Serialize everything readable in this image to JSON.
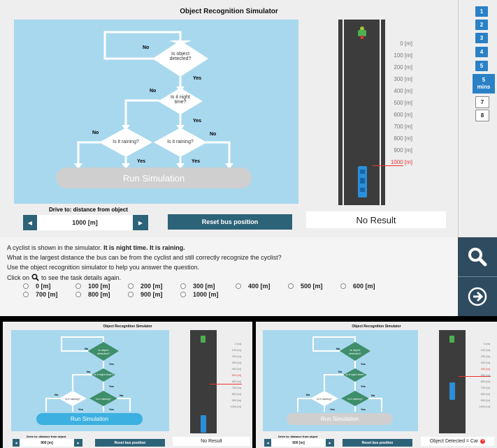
{
  "simulator": {
    "title": "Object Recognition Simulator",
    "flowchart": {
      "decision_detected": "Is object detected?",
      "decision_night": "Is it night time?",
      "decision_rain_left": "Is it raining?",
      "decision_rain_right": "Is it raining?",
      "no": "No",
      "yes": "Yes",
      "run_button": "Run Simulation"
    },
    "distances": [
      "0 [m]",
      "100 [m]",
      "200 [m]",
      "300 [m]",
      "400 [m]",
      "500 [m]",
      "600 [m]",
      "700 [m]",
      "800 [m]",
      "900 [m]",
      "1000 [m]"
    ],
    "control": {
      "label": "Drive to: distance from object",
      "value": "1000 [m]",
      "left_arrow": "◀",
      "right_arrow": "▶"
    },
    "reset_button": "Reset bus position",
    "result": "No Result",
    "colors": {
      "panel": "#a8d8ee",
      "decision": "#ffffff",
      "button": "#2d6378",
      "highlight": "#e33333"
    }
  },
  "nav": {
    "items": [
      {
        "label": "1",
        "state": "done"
      },
      {
        "label": "2",
        "state": "done"
      },
      {
        "label": "3",
        "state": "done"
      },
      {
        "label": "4",
        "state": "done"
      },
      {
        "label": "5",
        "state": "done"
      },
      {
        "label": "5\nmins",
        "state": "current"
      },
      {
        "label": "7",
        "state": "todo"
      },
      {
        "label": "8",
        "state": "todo"
      }
    ]
  },
  "question": {
    "intro_plain": "A cyclist is shown in the simulator. ",
    "intro_bold": "It is night time. It is raining.",
    "line2": "What is the largest distance the bus can be from the cyclist and still correctly recognize the cyclist?",
    "line3": "Use the object recognition simulator to help you answer the question.",
    "line4_prefix": "Click on",
    "line4_suffix": "to see the task details again.",
    "options": [
      "0 [m]",
      "100 [m]",
      "200 [m]",
      "300 [m]",
      "400 [m]",
      "500 [m]",
      "600 [m]",
      "700 [m]",
      "800 [m]",
      "900 [m]",
      "1000 [m]"
    ]
  },
  "actions": {
    "search_icon": "magnifier-icon",
    "next_icon": "arrow-right-circle-icon"
  },
  "example_left": {
    "title": "Object Recognition Simulator",
    "decision_detected": "Is object detected?",
    "decision_night": "Is it night time?",
    "rain_left": "Is it raining?",
    "rain_right": "Is it raining?",
    "no": "No",
    "yes": "Yes",
    "run_button": "Run Simulation",
    "distances": [
      "0 [m]",
      "100 [m]",
      "200 [m]",
      "300 [m]",
      "400 [m]",
      "500 [m]",
      "600 [m]",
      "700 [m]",
      "800 [m]",
      "900 [m]",
      "1000 [m]"
    ],
    "control_label": "Drive to: distance from object",
    "control_value": "900 [m]",
    "reset_button": "Reset bus position",
    "result": "No Result"
  },
  "example_right": {
    "title": "Object Recognition Simulator",
    "decision_detected": "Is object detected?",
    "decision_night": "Is it night time?",
    "rain_left": "Is it raining?",
    "rain_right": "Is it raining?",
    "no": "No",
    "yes": "Yes",
    "run_button": "Run Simulation",
    "distances": [
      "0 [m]",
      "100 [m]",
      "200 [m]",
      "300 [m]",
      "400 [m]",
      "500 [m]",
      "600 [m]",
      "700 [m]",
      "800 [m]",
      "900 [m]",
      "1000 [m]"
    ],
    "control_label": "Drive to: distance from object",
    "control_value": "500 [m]",
    "reset_button": "Reset bus position",
    "result": "Object Detected = Car"
  }
}
